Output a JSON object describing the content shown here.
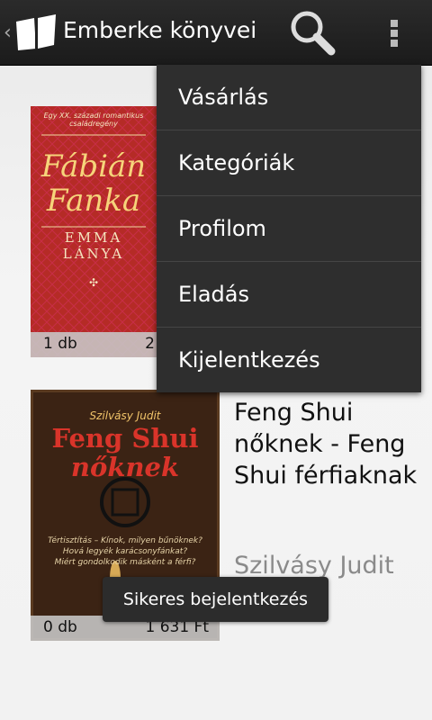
{
  "actionbar": {
    "title": "Emberke könyvei",
    "up_chevron": "‹",
    "icons": {
      "app": "open-book-icon",
      "search": "search-icon",
      "overflow": "overflow-menu-icon"
    }
  },
  "books": [
    {
      "title": "",
      "author": "",
      "quantity": "1 db",
      "price": "2",
      "cover": {
        "top_line": "Egy XX. századi romantikus családregény",
        "name_line1": "Fábián",
        "name_line2": "Fanka",
        "subtitle_line1": "EMMA",
        "subtitle_line2": "LÁNYA"
      }
    },
    {
      "title": "Feng Shui nőknek - Feng Shui férfiaknak",
      "author": "Szilvásy Judit",
      "quantity": "0 db",
      "price": "1 631 Ft",
      "cover": {
        "author": "Szilvásy Judit",
        "title_line1": "Feng Shui",
        "title_line2": "nőknek",
        "blurb1": "Tértisztítás – Kínok, milyen bűnöknek?",
        "blurb2": "Hová legyék karácsonyfánkat?",
        "blurb3": "Miért gondolkodik másként a férfi?"
      }
    }
  ],
  "menu": {
    "items": [
      "Vásárlás",
      "Kategóriák",
      "Profilom",
      "Eladás",
      "Kijelentkezés"
    ]
  },
  "toast": {
    "message": "Sikeres bejelentkezés"
  },
  "colors": {
    "actionbar": "#1f1f1f",
    "menu": "#2e2e2e",
    "toast": "#2c2c2c"
  }
}
